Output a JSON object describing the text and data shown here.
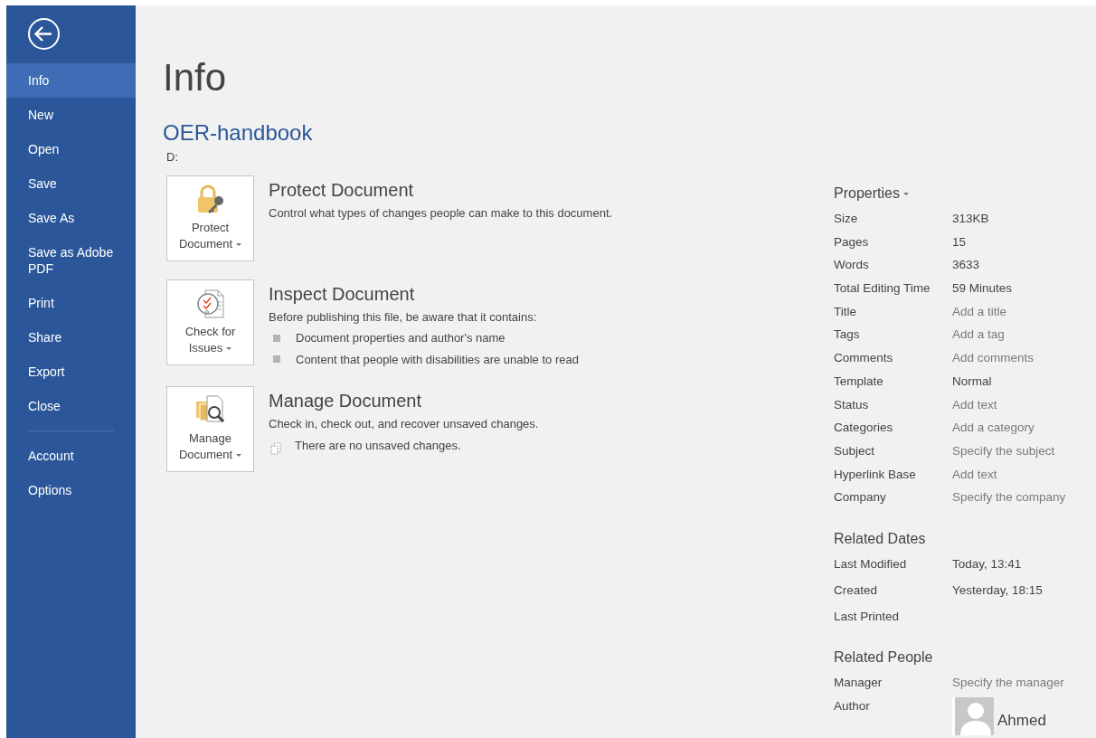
{
  "sidebar": {
    "items": [
      {
        "label": "Info",
        "selected": true
      },
      {
        "label": "New",
        "selected": false
      },
      {
        "label": "Open",
        "selected": false
      },
      {
        "label": "Save",
        "selected": false
      },
      {
        "label": "Save As",
        "selected": false
      },
      {
        "label": "Save as Adobe PDF",
        "selected": false
      },
      {
        "label": "Print",
        "selected": false
      },
      {
        "label": "Share",
        "selected": false
      },
      {
        "label": "Export",
        "selected": false
      },
      {
        "label": "Close",
        "selected": false
      }
    ],
    "bottom_items": [
      {
        "label": "Account",
        "selected": false
      },
      {
        "label": "Options",
        "selected": false
      }
    ]
  },
  "page_title": "Info",
  "document": {
    "name": "OER-handbook",
    "path": "D:"
  },
  "sections": [
    {
      "kind": "protect",
      "button": "Protect Document",
      "title": "Protect Document",
      "description": "Control what types of changes people can make to this document."
    },
    {
      "kind": "inspect",
      "button": "Check for Issues",
      "title": "Inspect Document",
      "description": "Before publishing this file, be aware that it contains:",
      "bullets": [
        "Document properties and author's name",
        "Content that people with disabilities are unable to read"
      ]
    },
    {
      "kind": "manage",
      "button": "Manage Document",
      "title": "Manage Document",
      "description": "Check in, check out, and recover unsaved changes.",
      "note": "There are no unsaved changes."
    }
  ],
  "properties": {
    "heading": "Properties",
    "rows": [
      {
        "label": "Size",
        "value": "313KB",
        "kind": "value"
      },
      {
        "label": "Pages",
        "value": "15",
        "kind": "value"
      },
      {
        "label": "Words",
        "value": "3633",
        "kind": "value"
      },
      {
        "label": "Total Editing Time",
        "value": "59 Minutes",
        "kind": "value"
      },
      {
        "label": "Title",
        "value": "Add a title",
        "kind": "hint"
      },
      {
        "label": "Tags",
        "value": "Add a tag",
        "kind": "hint"
      },
      {
        "label": "Comments",
        "value": "Add comments",
        "kind": "hint"
      },
      {
        "label": "Template",
        "value": "Normal",
        "kind": "value"
      },
      {
        "label": "Status",
        "value": "Add text",
        "kind": "hint"
      },
      {
        "label": "Categories",
        "value": "Add a category",
        "kind": "hint"
      },
      {
        "label": "Subject",
        "value": "Specify the subject",
        "kind": "hint"
      },
      {
        "label": "Hyperlink Base",
        "value": "Add text",
        "kind": "hint"
      },
      {
        "label": "Company",
        "value": "Specify the company",
        "kind": "hint"
      }
    ]
  },
  "related_dates": {
    "heading": "Related Dates",
    "rows": [
      {
        "label": "Last Modified",
        "value": "Today, 13:41"
      },
      {
        "label": "Created",
        "value": "Yesterday, 18:15"
      },
      {
        "label": "Last Printed"
      }
    ]
  },
  "related_people": {
    "heading": "Related People",
    "manager": {
      "label": "Manager",
      "value": "Specify the manager"
    },
    "author": {
      "label": "Author",
      "name": "Ahmed"
    }
  }
}
